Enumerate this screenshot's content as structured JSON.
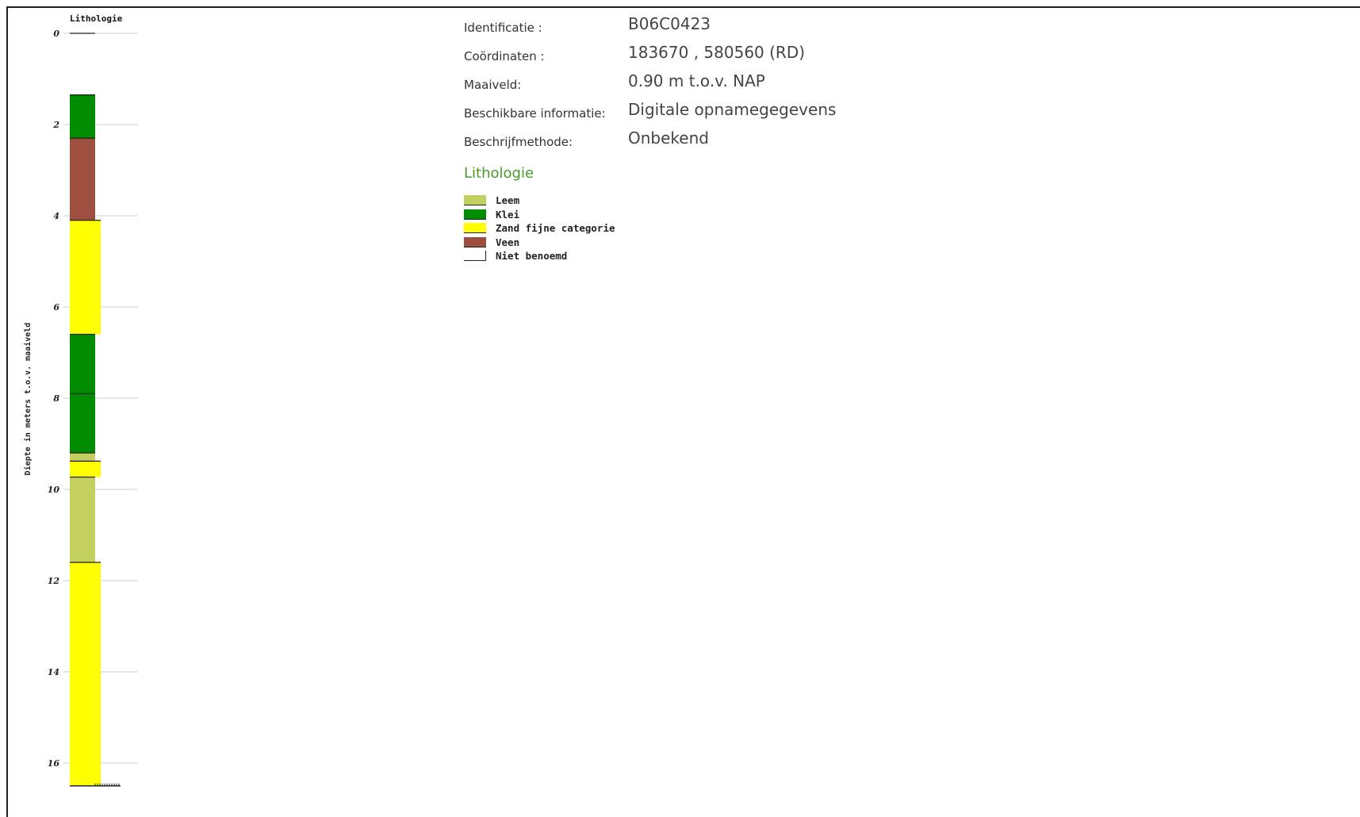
{
  "chart_data": {
    "type": "bar",
    "title": "Lithologie",
    "ylabel": "Diepte in meters t.o.v. maaiveld",
    "ylim": [
      0,
      16.5
    ],
    "yticks": [
      0,
      2,
      4,
      6,
      8,
      10,
      12,
      14,
      16
    ],
    "grid": true,
    "layers": [
      {
        "top": 0,
        "bottom": 1.35,
        "lithology": "Niet benoemd"
      },
      {
        "top": 1.35,
        "bottom": 2.3,
        "lithology": "Klei"
      },
      {
        "top": 2.3,
        "bottom": 4.1,
        "lithology": "Veen"
      },
      {
        "top": 4.1,
        "bottom": 6.6,
        "lithology": "Zand fijne categorie"
      },
      {
        "top": 6.6,
        "bottom": 7.9,
        "lithology": "Klei"
      },
      {
        "top": 7.9,
        "bottom": 9.2,
        "lithology": "Klei"
      },
      {
        "top": 9.2,
        "bottom": 9.38,
        "lithology": "Leem"
      },
      {
        "top": 9.38,
        "bottom": 9.73,
        "lithology": "Zand fijne categorie"
      },
      {
        "top": 9.73,
        "bottom": 11.6,
        "lithology": "Leem"
      },
      {
        "top": 11.6,
        "bottom": 16.5,
        "lithology": "Zand fijne categorie"
      }
    ]
  },
  "info": [
    {
      "label": "Identificatie :",
      "value": "B06C0423"
    },
    {
      "label": "Coördinaten :",
      "value": "183670 , 580560 (RD)"
    },
    {
      "label": "Maaiveld:",
      "value": "0.90 m t.o.v. NAP"
    },
    {
      "label": "Beschikbare informatie:",
      "value": "Digitale opnamegegevens"
    },
    {
      "label": "Beschrijfmethode:",
      "value": "Onbekend"
    }
  ],
  "legend_title": "Lithologie",
  "legend": [
    {
      "name": "Leem",
      "color": "#c3cf5f"
    },
    {
      "name": "Klei",
      "color": "#008c00"
    },
    {
      "name": "Zand fijne categorie",
      "color": "#ffff00"
    },
    {
      "name": "Veen",
      "color": "#9c4f3f"
    },
    {
      "name": "Niet benoemd",
      "color": "none"
    }
  ]
}
